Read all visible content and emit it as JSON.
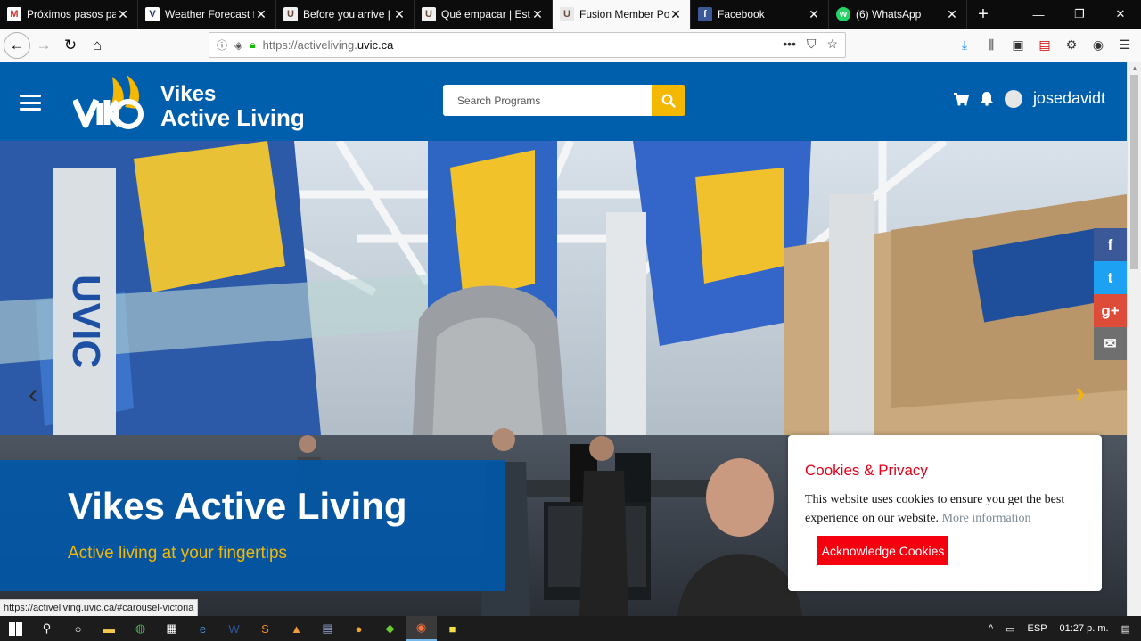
{
  "browser": {
    "tabs": [
      {
        "title": "Próximos pasos par",
        "favicon_letter": "M",
        "favicon_color": "#d93025",
        "active": false
      },
      {
        "title": "Weather Forecast fo",
        "favicon_letter": "V",
        "favicon_color": "#1a3a6e",
        "active": false
      },
      {
        "title": "Before you arrive | U",
        "favicon_letter": "U",
        "favicon_color": "#6b4a3a",
        "active": false
      },
      {
        "title": "Qué empacar | Estu",
        "favicon_letter": "U",
        "favicon_color": "#6b4a3a",
        "active": false
      },
      {
        "title": "Fusion Member Por",
        "favicon_letter": "U",
        "favicon_color": "#6b4a3a",
        "active": true
      },
      {
        "title": "Facebook",
        "favicon_letter": "f",
        "favicon_color": "#3b5998",
        "active": false
      },
      {
        "title": "(6) WhatsApp",
        "favicon_letter": "w",
        "favicon_color": "#25d366",
        "active": false
      }
    ],
    "url_prefix": "https://activeliving.",
    "url_domain": "uvic.ca"
  },
  "header": {
    "brand_line1": "Vikes",
    "brand_line2": "Active Living",
    "search_placeholder": "Search Programs",
    "username": "josedavidt",
    "brand_color": "#005fad",
    "accent_color": "#f5b800"
  },
  "hero": {
    "title": "Vikes Active Living",
    "subtitle": "Active living at your fingertips"
  },
  "social": [
    {
      "label": "f",
      "icon": "facebook-icon"
    },
    {
      "label": "t",
      "icon": "twitter-icon"
    },
    {
      "label": "g+",
      "icon": "google-plus-icon"
    },
    {
      "label": "✉",
      "icon": "mail-icon"
    }
  ],
  "cookie": {
    "title": "Cookies & Privacy",
    "message": "This website uses cookies to ensure you get the best experience on our website.",
    "more_link": "More information",
    "button": "Acknowledge Cookies"
  },
  "status_url": "https://activeliving.uvic.ca/#carousel-victoria",
  "taskbar": {
    "language": "ESP",
    "time": "01:27 p. m."
  }
}
